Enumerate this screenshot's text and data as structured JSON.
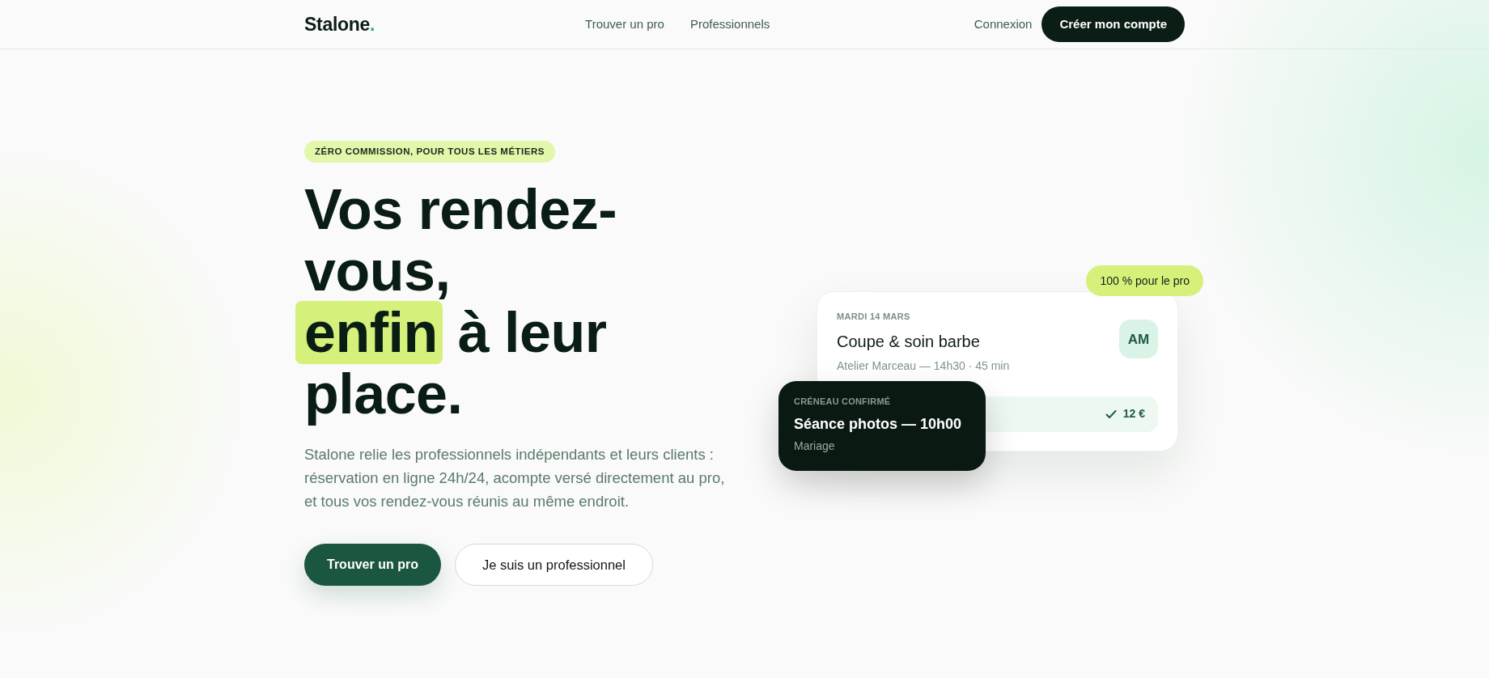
{
  "header": {
    "logo": {
      "name": "Stalone",
      "mark": "."
    },
    "nav": [
      {
        "label": "Trouver un pro"
      },
      {
        "label": "Professionnels"
      }
    ],
    "login": "Connexion",
    "signup": "Créer mon compte"
  },
  "hero": {
    "badge": "ZÉRO COMMISSION, POUR TOUS LES MÉTIERS",
    "title": {
      "before": "Vos rendez-vous,",
      "highlight": "enfin",
      "after": "à leur place."
    },
    "description": "Stalone relie les professionnels indépendants et leurs clients : réservation en ligne 24h/24, acompte versé directement au pro, et tous vos rendez-vous réunis au même endroit.",
    "buttons": [
      {
        "label": "Trouver un pro",
        "kind": "primary"
      },
      {
        "label": "Je suis un professionnel",
        "kind": "secondary"
      }
    ]
  },
  "preview": {
    "pill": "100 % pour le pro",
    "booking": {
      "date": "MARDI 14 MARS",
      "service": "Coupe & soin barbe",
      "details": "Atelier Marceau — 14h30 · 45 min",
      "initials": "AM",
      "amount": "12 €"
    },
    "confirmation": {
      "label": "CRÉNEAU CONFIRMÉ",
      "title": "Séance photos — 10h00",
      "subtitle": "Mariage"
    }
  }
}
